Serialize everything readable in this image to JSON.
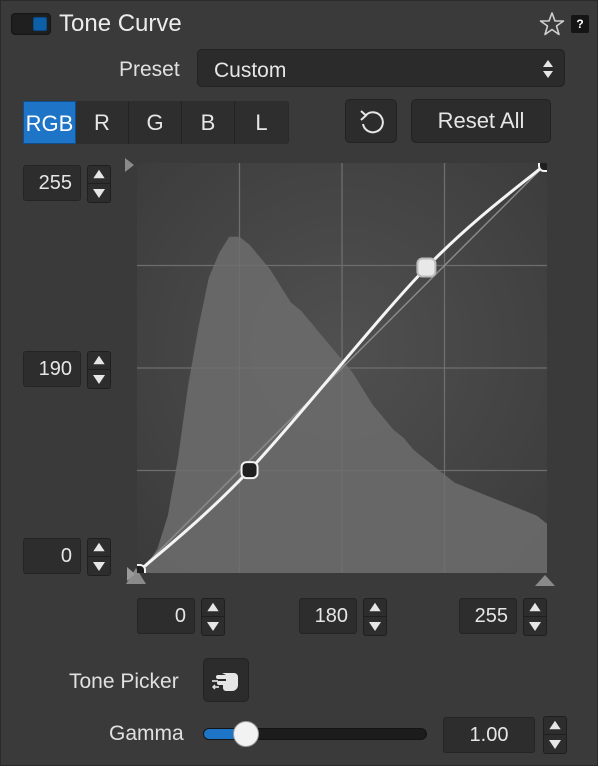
{
  "header": {
    "title": "Tone Curve",
    "enabled": true,
    "favorite_icon": "star-outline-icon",
    "help_label": "?"
  },
  "preset": {
    "label": "Preset",
    "value": "Custom"
  },
  "channels": {
    "tabs": [
      "RGB",
      "R",
      "G",
      "B",
      "L"
    ],
    "active": "RGB"
  },
  "toolbar": {
    "undo_icon": "rotate-undo-icon",
    "reset_all_label": "Reset All"
  },
  "output_levels": {
    "white": "255",
    "mid": "190",
    "black": "0"
  },
  "input_levels": {
    "black": "0",
    "mid": "180",
    "white": "255"
  },
  "curve": {
    "points": [
      [
        0,
        0
      ],
      [
        70,
        64
      ],
      [
        180,
        190
      ],
      [
        255,
        255
      ]
    ],
    "selected_point": [
      180,
      190
    ]
  },
  "histogram": {
    "values": [
      0,
      2,
      6,
      14,
      28,
      46,
      60,
      72,
      78,
      82,
      82,
      80,
      77,
      74,
      70,
      66,
      64,
      61,
      58,
      55,
      52,
      49,
      45,
      41,
      38,
      35,
      33,
      30,
      28,
      26,
      24,
      22,
      21,
      20,
      19,
      18,
      17,
      16,
      15,
      14,
      12
    ]
  },
  "tone_picker": {
    "label": "Tone Picker",
    "icon": "hand-picker-icon"
  },
  "gamma": {
    "label": "Gamma",
    "value": "1.00",
    "slider_fraction": 0.19
  },
  "colors": {
    "accent": "#1e74c7",
    "panel": "#3a3a3a",
    "graph_bg": "#454545",
    "histogram": "#6a6a6a"
  }
}
